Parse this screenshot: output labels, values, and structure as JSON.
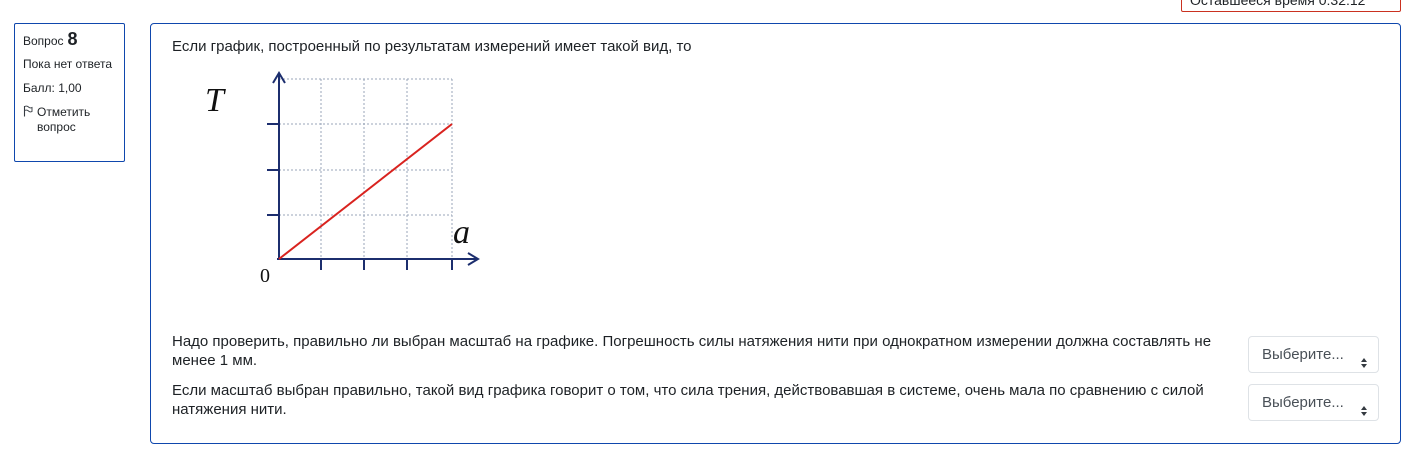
{
  "timer": {
    "text": "Оставшееся время 0:32:12"
  },
  "question_info": {
    "label": "Вопрос",
    "number": "8",
    "status": "Пока нет ответа",
    "grade": "Балл: 1,00",
    "flag_label": "Отметить вопрос",
    "flag_icon": "flag-icon"
  },
  "question": {
    "text": "Если график, построенный по результатам измерений имеет такой вид, то",
    "graph": {
      "y_label": "T",
      "x_label": "a",
      "origin_label": "0"
    },
    "subquestions": [
      {
        "text": "Надо проверить, правильно ли выбран масштаб на графике. Погрешность силы натяжения нити при однократном измерении должна составлять  не менее 1 мм.",
        "select_value": "Выберите..."
      },
      {
        "text": "Если масштаб выбран правильно, такой вид графика говорит о том, что сила трения, действовавшая в системе, очень мала по сравнению с силой натяжения нити.",
        "select_value": "Выберите..."
      }
    ]
  },
  "colors": {
    "border": "#0f47ad",
    "line": "#d9231f",
    "axis": "#1c2e6e",
    "timer_border": "#ca3120"
  }
}
